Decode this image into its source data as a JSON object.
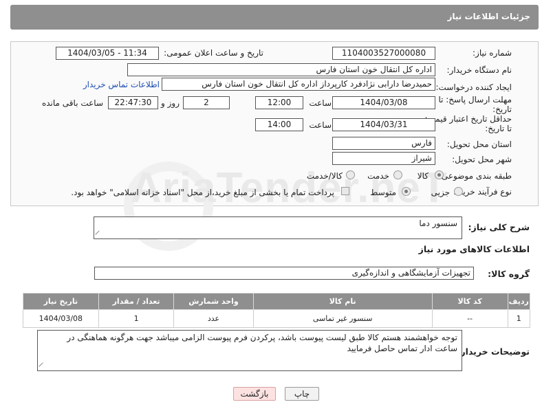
{
  "header": {
    "title": "جزئیات اطلاعات نیاز"
  },
  "watermark": {
    "text": "AriaTender.neT"
  },
  "form": {
    "need_number_label": "شماره نیاز:",
    "need_number": "1104003527000080",
    "announce_label": "تاریخ و ساعت اعلان عمومی:",
    "announce_value": "1404/03/05 - 11:34",
    "buyer_org_label": "نام دستگاه خریدار:",
    "buyer_org": "اداره کل انتقال خون استان فارس",
    "creator_label": "ایجاد کننده درخواست:",
    "creator": "حمیدرضا دارابی نژادفرد کارپرداز اداره کل انتقال خون استان فارس",
    "contact_link": "اطلاعات تماس خریدار",
    "reply_deadline_label": "مهلت ارسال پاسخ: تا تاریخ:",
    "reply_date": "1404/03/08",
    "time_label": "ساعت",
    "reply_time": "12:00",
    "days_value": "2",
    "days_label": "روز و",
    "remaining_time": "22:47:30",
    "remaining_label": "ساعت باقی مانده",
    "price_validity_label": "حداقل تاریخ اعتبار قیمت: تا تاریخ:",
    "price_date": "1404/03/31",
    "price_time_label": "ساعت",
    "price_time": "14:00",
    "province_label": "استان محل تحویل:",
    "province": "فارس",
    "city_label": "شهر محل تحویل:",
    "city": "شیراز",
    "category_label": "طبقه بندی موضوعی:",
    "category_options": [
      "کالا",
      "خدمت",
      "کالا/خدمت"
    ],
    "process_label": "نوع فرآیند خرید :",
    "process_options": [
      "جزیی",
      "متوسط"
    ],
    "payment_note": "پرداخت تمام یا بخشی از مبلغ خرید،از محل \"اسناد خزانه اسلامی\" خواهد بود."
  },
  "description": {
    "label": "شرح کلی نیاز:",
    "value": "سنسور دما"
  },
  "goods_info": {
    "title": "اطلاعات کالاهای مورد نیاز"
  },
  "goods_group": {
    "label": "گروه کالا:",
    "value": "تجهیزات آزمایشگاهی و اندازه‌گیری"
  },
  "table": {
    "headers": [
      "ردیف",
      "کد کالا",
      "نام کالا",
      "واحد شمارش",
      "تعداد / مقدار",
      "تاریخ نیاز"
    ],
    "rows": [
      [
        "1",
        "--",
        "سنسور غیر تماسی",
        "عدد",
        "1",
        "1404/03/08"
      ]
    ]
  },
  "buyer_notes": {
    "label": "توضیحات خریدار:",
    "value": "توجه خواهشمند هستم کالا طبق لیست پیوست باشد، پرکردن فرم پیوست الزامی میباشد جهت هرگونه هماهنگی در ساعت ادار تماس حاصل فرمایید"
  },
  "buttons": {
    "print": "چاپ",
    "back": "بازگشت"
  }
}
